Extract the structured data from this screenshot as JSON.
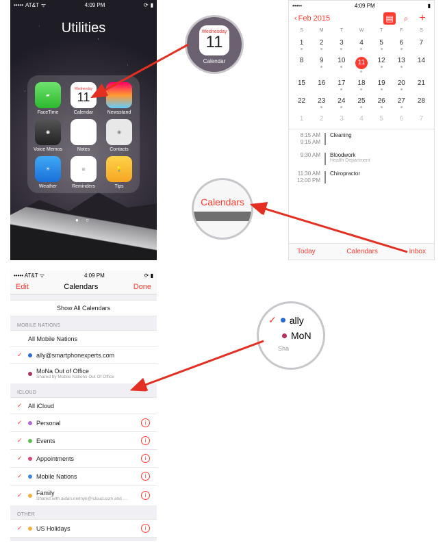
{
  "colors": {
    "accent": "#ff3b30"
  },
  "statusbar": {
    "carrier": "AT&T",
    "time": "4:09 PM"
  },
  "folder": {
    "title": "Utilities",
    "apps": [
      {
        "name": "FaceTime",
        "id": "facetime"
      },
      {
        "name": "Calendar",
        "id": "calendar",
        "day": "Wednesday",
        "num": "11"
      },
      {
        "name": "Newsstand",
        "id": "newsstand"
      },
      {
        "name": "Voice Memos",
        "id": "voicememos"
      },
      {
        "name": "Notes",
        "id": "notes"
      },
      {
        "name": "Contacts",
        "id": "contacts"
      },
      {
        "name": "Weather",
        "id": "weather"
      },
      {
        "name": "Reminders",
        "id": "reminders"
      },
      {
        "name": "Tips",
        "id": "tips"
      }
    ]
  },
  "callout1": {
    "day": "Wednesday",
    "num": "11",
    "label": "Calendar"
  },
  "callout2": {
    "text": "Calendars"
  },
  "callout3": {
    "line1": "ally",
    "line2": "MoN",
    "line2sub": "Sha"
  },
  "month": {
    "back": "Feb 2015",
    "dow": [
      "S",
      "M",
      "T",
      "W",
      "T",
      "F",
      "S"
    ],
    "weeks": [
      [
        1,
        2,
        3,
        4,
        5,
        6,
        7
      ],
      [
        8,
        9,
        10,
        11,
        12,
        13,
        14
      ],
      [
        15,
        16,
        17,
        18,
        19,
        20,
        21
      ],
      [
        22,
        23,
        24,
        25,
        26,
        27,
        28
      ],
      [
        1,
        2,
        3,
        4,
        5,
        6,
        7
      ]
    ],
    "today": 11,
    "dotted": [
      1,
      2,
      3,
      4,
      5,
      6,
      9,
      10,
      11,
      12,
      13,
      17,
      18,
      19,
      20,
      23,
      24,
      25,
      26,
      27
    ],
    "events": [
      {
        "t1": "8:15 AM",
        "t2": "9:15 AM",
        "title": "Cleaning",
        "sub": ""
      },
      {
        "t1": "9:30 AM",
        "t2": "",
        "title": "Bloodwork",
        "sub": "Health Department"
      },
      {
        "t1": "11:30 AM",
        "t2": "12:00 PM",
        "title": "Chiropractor",
        "sub": ""
      }
    ],
    "toolbar": {
      "today": "Today",
      "calendars": "Calendars",
      "inbox": "Inbox"
    }
  },
  "calendars": {
    "edit": "Edit",
    "title": "Calendars",
    "done": "Done",
    "showall": "Show All Calendars",
    "sections": [
      {
        "header": "MOBILE NATIONS",
        "items": [
          {
            "checked": false,
            "color": "",
            "name": "All Mobile Nations",
            "sub": "",
            "info": false
          },
          {
            "checked": true,
            "color": "#2b6bd4",
            "name": "ally@smartphonexperts.com",
            "sub": "",
            "info": false
          },
          {
            "checked": false,
            "color": "#b03060",
            "name": "MoNa Out of Office",
            "sub": "Shared by Mobile Nations Out Of Office",
            "info": false
          }
        ]
      },
      {
        "header": "ICLOUD",
        "items": [
          {
            "checked": true,
            "color": "",
            "name": "All iCloud",
            "sub": "",
            "info": false
          },
          {
            "checked": true,
            "color": "#b267d6",
            "name": "Personal",
            "sub": "",
            "info": true
          },
          {
            "checked": true,
            "color": "#57c24c",
            "name": "Events",
            "sub": "",
            "info": true
          },
          {
            "checked": true,
            "color": "#e0457e",
            "name": "Appointments",
            "sub": "",
            "info": true
          },
          {
            "checked": true,
            "color": "#3a89e0",
            "name": "Mobile Nations",
            "sub": "",
            "info": true
          },
          {
            "checked": true,
            "color": "#f3b23c",
            "name": "Family",
            "sub": "Shared with aidan.melnyk@icloud.com and …",
            "info": true
          }
        ]
      },
      {
        "header": "OTHER",
        "items": [
          {
            "checked": true,
            "color": "#f3b23c",
            "name": "US Holidays",
            "sub": "",
            "info": true
          }
        ]
      }
    ]
  }
}
